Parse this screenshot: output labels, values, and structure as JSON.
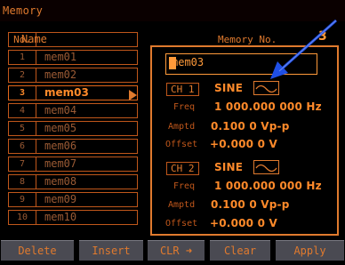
{
  "header": {
    "title": "Memory"
  },
  "list": {
    "col_no": "No.",
    "col_name": "Name",
    "rows": [
      {
        "no": "1",
        "name": "mem01"
      },
      {
        "no": "2",
        "name": "mem02"
      },
      {
        "no": "3",
        "name": "mem03"
      },
      {
        "no": "4",
        "name": "mem04"
      },
      {
        "no": "5",
        "name": "mem05"
      },
      {
        "no": "6",
        "name": "mem06"
      },
      {
        "no": "7",
        "name": "mem07"
      },
      {
        "no": "8",
        "name": "mem08"
      },
      {
        "no": "9",
        "name": "mem09"
      },
      {
        "no": "10",
        "name": "mem10"
      }
    ],
    "selected_index": 2
  },
  "detail": {
    "memory_no_label": "Memory No.",
    "memory_no_value": "3",
    "name_value": "mem03",
    "ch1": {
      "label": "CH 1",
      "waveform": "SINE",
      "freq_label": "Freq",
      "freq_value": "1 000.000 000 Hz",
      "amptd_label": "Amptd",
      "amptd_value": "0.100 0 Vp-p",
      "offset_label": "Offset",
      "offset_value": "+0.000 0 V"
    },
    "ch2": {
      "label": "CH 2",
      "waveform": "SINE",
      "freq_label": "Freq",
      "freq_value": "1 000.000 000 Hz",
      "amptd_label": "Amptd",
      "amptd_value": "0.100 0 Vp-p",
      "offset_label": "Offset",
      "offset_value": "+0.000 0 V"
    }
  },
  "buttons": {
    "delete": "Delete",
    "insert": "Insert",
    "clr": "CLR ➜",
    "clear": "Clear",
    "apply": "Apply"
  },
  "icons": {
    "wave1": "sine-wave-icon",
    "wave2": "sine-wave-icon",
    "pointer": "blue-arrow-icon",
    "selection": "selection-arrow-icon"
  },
  "colors": {
    "accent": "#e07a2e",
    "highlight": "#ff9a3a",
    "button_bg": "#4a4a52",
    "annotation_arrow": "#1f4fe6"
  }
}
